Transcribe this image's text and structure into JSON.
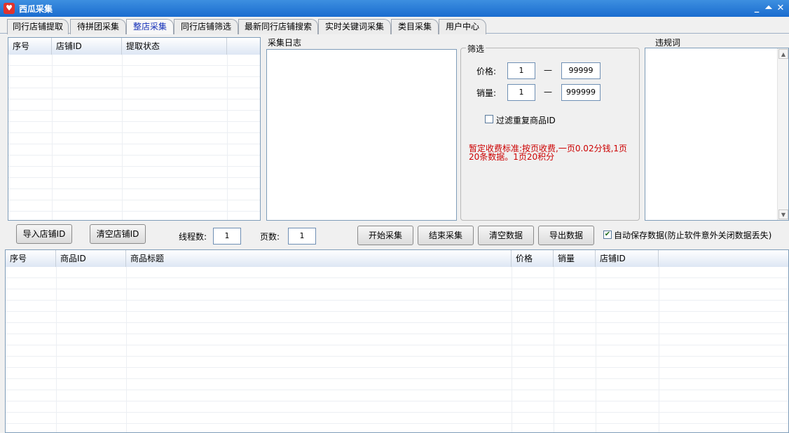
{
  "window": {
    "title": "西瓜采集",
    "icon": "heart-logo-icon",
    "controls": [
      "minimize-icon",
      "restore-icon",
      "close-icon"
    ]
  },
  "tabs": [
    {
      "label": "同行店铺提取",
      "active": false
    },
    {
      "label": "待拼团采集",
      "active": false
    },
    {
      "label": "整店采集",
      "active": true
    },
    {
      "label": "同行店铺筛选",
      "active": false
    },
    {
      "label": "最新同行店铺搜索",
      "active": false
    },
    {
      "label": "实时关键词采集",
      "active": false
    },
    {
      "label": "类目采集",
      "active": false
    },
    {
      "label": "用户中心",
      "active": false
    }
  ],
  "shop_table": {
    "headers": [
      "序号",
      "店铺ID",
      "提取状态"
    ]
  },
  "log_panel": {
    "label": "采集日志"
  },
  "filter_panel": {
    "title": "筛选",
    "price_label": "价格:",
    "price_min": "1",
    "price_max": "99999",
    "sales_label": "销量:",
    "sales_min": "1",
    "sales_max": "999999",
    "dash": "—",
    "dedupe_label": "过滤重复商品ID",
    "dedupe_checked": false,
    "notice": "暂定收费标准:按页收费,一页0.02分钱,1页20条数据。1页20积分",
    "notice_color": "#cc0000"
  },
  "banned_words": {
    "label": "违规词"
  },
  "toolbar": {
    "import_shop_label": "导入店铺ID",
    "clear_shop_label": "清空店铺ID",
    "threads_label": "线程数:",
    "threads_value": "1",
    "pages_label": "页数:",
    "pages_value": "1",
    "start_label": "开始采集",
    "stop_label": "结束采集",
    "clear_data_label": "清空数据",
    "export_label": "导出数据",
    "autosave_label": "自动保存数据(防止软件意外关闭数据丢失)",
    "autosave_checked": true
  },
  "product_table": {
    "headers": [
      "序号",
      "商品ID",
      "商品标题",
      "价格",
      "销量",
      "店铺ID"
    ]
  },
  "colors": {
    "titlebar": "#1a6ccf",
    "active_tab_text": "#1430b8",
    "grid_border": "#7f9db9"
  }
}
